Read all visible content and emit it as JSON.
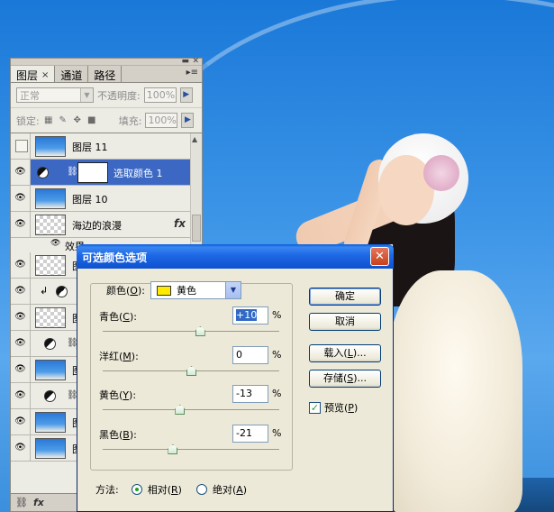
{
  "layers_panel": {
    "tabs": [
      {
        "label": "图层",
        "close": "×"
      },
      {
        "label": "通道"
      },
      {
        "label": "路径"
      }
    ],
    "blend_mode": "正常",
    "opacity_label": "不透明度:",
    "opacity_value": "100%",
    "lock_label": "锁定:",
    "fill_label": "填充:",
    "fill_value": "100%",
    "layers": [
      {
        "name": "图层 11",
        "visible": false
      },
      {
        "name": "选取颜色 1",
        "visible": true,
        "selected": true
      },
      {
        "name": "图层 10",
        "visible": true
      },
      {
        "name": "海边的浪漫",
        "visible": true,
        "fx": "fx"
      },
      {
        "name": "效果",
        "indent": true
      },
      {
        "name": "图",
        "visible": true
      },
      {
        "name": "",
        "visible": true
      },
      {
        "name": "图",
        "visible": true
      },
      {
        "name": "图",
        "visible": true
      },
      {
        "name": "图",
        "visible": true
      },
      {
        "name": "",
        "visible": true
      },
      {
        "name": "图",
        "visible": true
      },
      {
        "name": "图",
        "visible": true
      }
    ],
    "bottom_icons": [
      "link-icon",
      "fx-icon"
    ]
  },
  "dialog": {
    "title": "可选颜色选项",
    "close_glyph": "✕",
    "color_label": "颜色(",
    "color_accel": "O",
    "color_label_end": "):",
    "color_value": "黄色",
    "color_swatch": "#ffea00",
    "sliders": [
      {
        "label": "青色(",
        "accel": "C",
        "label_end": "):",
        "value": "+10",
        "position": 0.55,
        "selected": true
      },
      {
        "label": "洋红(",
        "accel": "M",
        "label_end": "):",
        "value": "0",
        "position": 0.5,
        "selected": false
      },
      {
        "label": "黄色(",
        "accel": "Y",
        "label_end": "):",
        "value": "-13",
        "position": 0.435,
        "selected": false
      },
      {
        "label": "黑色(",
        "accel": "B",
        "label_end": "):",
        "value": "-21",
        "position": 0.395,
        "selected": false
      }
    ],
    "percent": "%",
    "buttons": {
      "ok": "确定",
      "cancel": "取消",
      "load": "载入(",
      "load_accel": "L",
      "load_end": ")...",
      "save": "存储(",
      "save_accel": "S",
      "save_end": ")..."
    },
    "preview": {
      "label": "预览(",
      "accel": "P",
      "label_end": ")",
      "checked": true
    },
    "method": {
      "label": "方法:",
      "relative": {
        "label": "相对(",
        "accel": "R",
        "label_end": ")",
        "checked": true
      },
      "absolute": {
        "label": "绝对(",
        "accel": "A",
        "label_end": ")",
        "checked": false
      }
    }
  }
}
